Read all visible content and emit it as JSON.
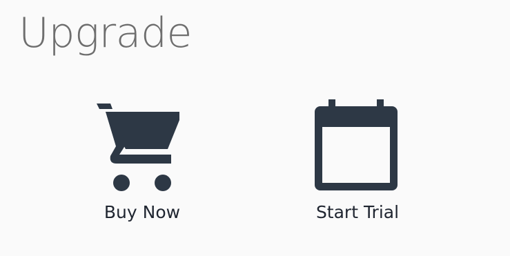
{
  "page": {
    "title": "Upgrade"
  },
  "options": [
    {
      "label": "Buy Now",
      "icon": "shopping-cart-icon"
    },
    {
      "label": "Start Trial",
      "icon": "calendar-icon"
    }
  ],
  "colors": {
    "background": "#fafafa",
    "title": "#6e6e6e",
    "icon": "#2d3845",
    "label": "#1f2530"
  }
}
